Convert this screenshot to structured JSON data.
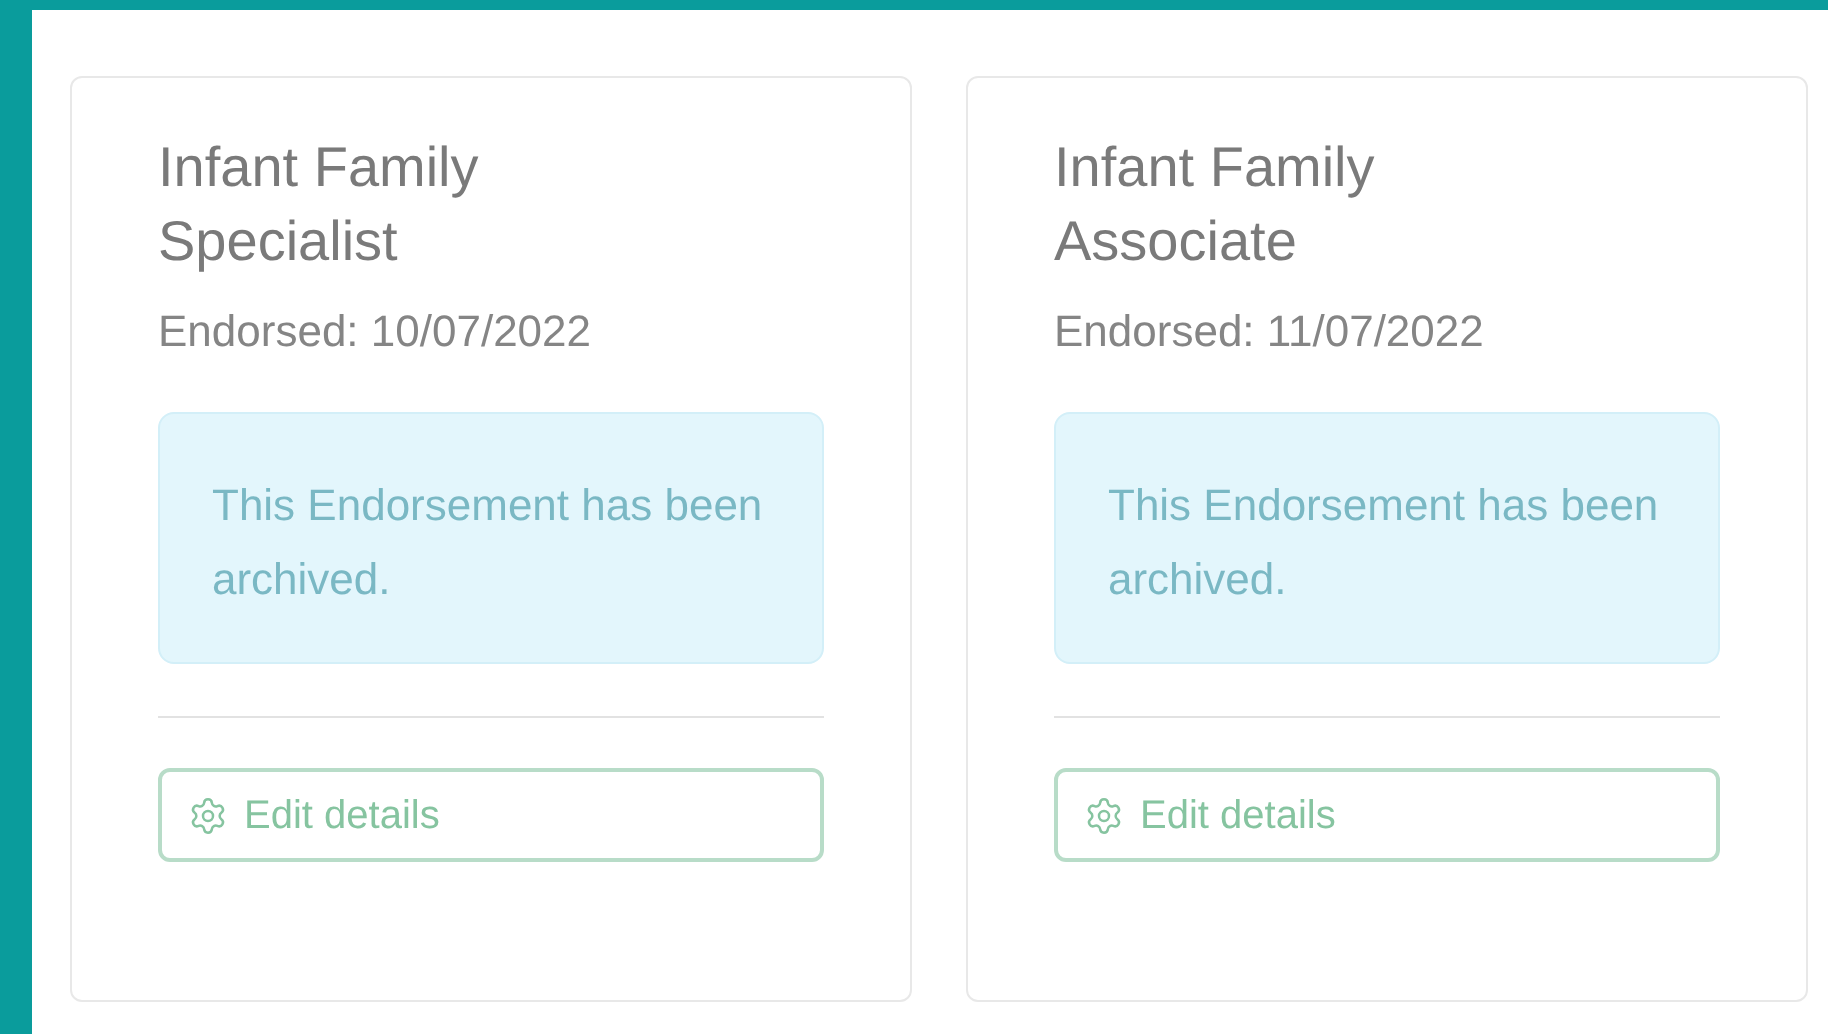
{
  "cards": [
    {
      "title": "Infant Family Specialist",
      "endorsed": "Endorsed: 10/07/2022",
      "notice": "This Endorsement has been archived.",
      "button": "Edit details"
    },
    {
      "title": "Infant Family Associate",
      "endorsed": "Endorsed: 11/07/2022",
      "notice": "This Endorsement has been archived.",
      "button": "Edit details"
    }
  ]
}
